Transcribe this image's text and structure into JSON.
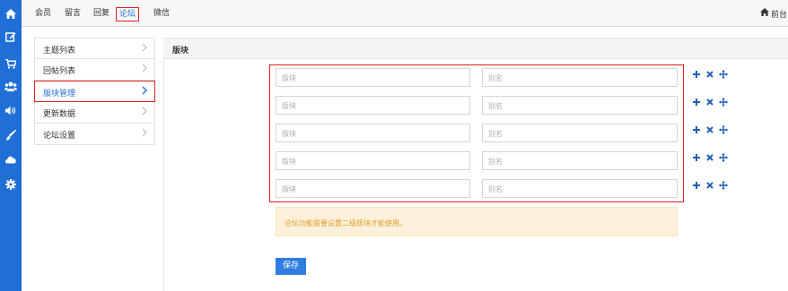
{
  "sidebar_icons": [
    "home-icon",
    "edit-icon",
    "cart-icon",
    "users-icon",
    "volume-icon",
    "brush-icon",
    "cloud-icon",
    "gear-icon"
  ],
  "topnav": {
    "tabs": [
      {
        "label": "会员"
      },
      {
        "label": "留言"
      },
      {
        "label": "回复"
      },
      {
        "label": "论坛",
        "active": true
      },
      {
        "label": "微信"
      }
    ],
    "home_label": "前台"
  },
  "subnav": {
    "items": [
      {
        "label": "主题列表"
      },
      {
        "label": "回帖列表"
      },
      {
        "label": "版块管理",
        "active": true
      },
      {
        "label": "更新数据"
      },
      {
        "label": "论坛设置"
      }
    ]
  },
  "panel": {
    "title": "版块"
  },
  "board_rows": [
    {
      "name_placeholder": "版块",
      "alias_placeholder": "别名"
    },
    {
      "name_placeholder": "版块",
      "alias_placeholder": "别名"
    },
    {
      "name_placeholder": "版块",
      "alias_placeholder": "别名"
    },
    {
      "name_placeholder": "版块",
      "alias_placeholder": "别名"
    },
    {
      "name_placeholder": "版块",
      "alias_placeholder": "别名"
    }
  ],
  "notice": "论坛功能需要设置二级版块才能使用。",
  "save_label": "保存",
  "colors": {
    "accent": "#1f6fd6",
    "active_outline": "#e02020",
    "notice_bg": "#fcf0da",
    "notice_text": "#e0a030",
    "save_bg": "#2f7de0"
  }
}
